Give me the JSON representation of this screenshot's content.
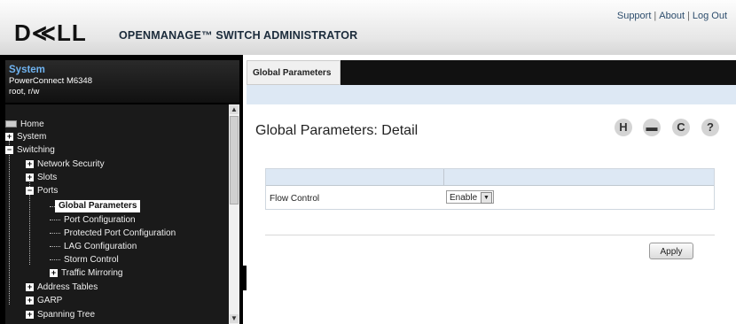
{
  "header": {
    "logo": "D≪LL",
    "product": "OPENMANAGE™ SWITCH ADMINISTRATOR",
    "links": [
      "Support",
      "About",
      "Log Out"
    ],
    "separator": "|"
  },
  "system": {
    "title": "System",
    "model": "PowerConnect M6348",
    "user": "root, r/w"
  },
  "tree": {
    "items": [
      {
        "label": "Home"
      },
      {
        "label": "System",
        "toggle": "+"
      },
      {
        "label": "Switching",
        "toggle": "−"
      },
      {
        "label": "Network Security",
        "toggle": "+"
      },
      {
        "label": "Slots",
        "toggle": "+"
      },
      {
        "label": "Ports",
        "toggle": "−"
      },
      {
        "label": "Global Parameters",
        "selected": true
      },
      {
        "label": "Port Configuration"
      },
      {
        "label": "Protected Port Configuration"
      },
      {
        "label": "LAG Configuration"
      },
      {
        "label": "Storm Control"
      },
      {
        "label": "Traffic Mirroring",
        "toggle": "+"
      },
      {
        "label": "Address Tables",
        "toggle": "+"
      },
      {
        "label": "GARP",
        "toggle": "+"
      },
      {
        "label": "Spanning Tree",
        "toggle": "+"
      }
    ]
  },
  "tabs": [
    {
      "label": "Global Parameters",
      "active": true
    }
  ],
  "page": {
    "title": "Global Parameters: Detail",
    "toolbar_icons": [
      {
        "name": "save-icon",
        "glyph": "H"
      },
      {
        "name": "print-icon",
        "glyph": "▬"
      },
      {
        "name": "refresh-icon",
        "glyph": "C"
      },
      {
        "name": "help-icon",
        "glyph": "?"
      }
    ]
  },
  "form": {
    "flow_control": {
      "label": "Flow Control",
      "value": "Enable"
    },
    "apply_label": "Apply"
  },
  "colors": {
    "header_link": "#2d4d6d",
    "system_title": "#6fb3f0",
    "table_header": "#dde8f4"
  }
}
